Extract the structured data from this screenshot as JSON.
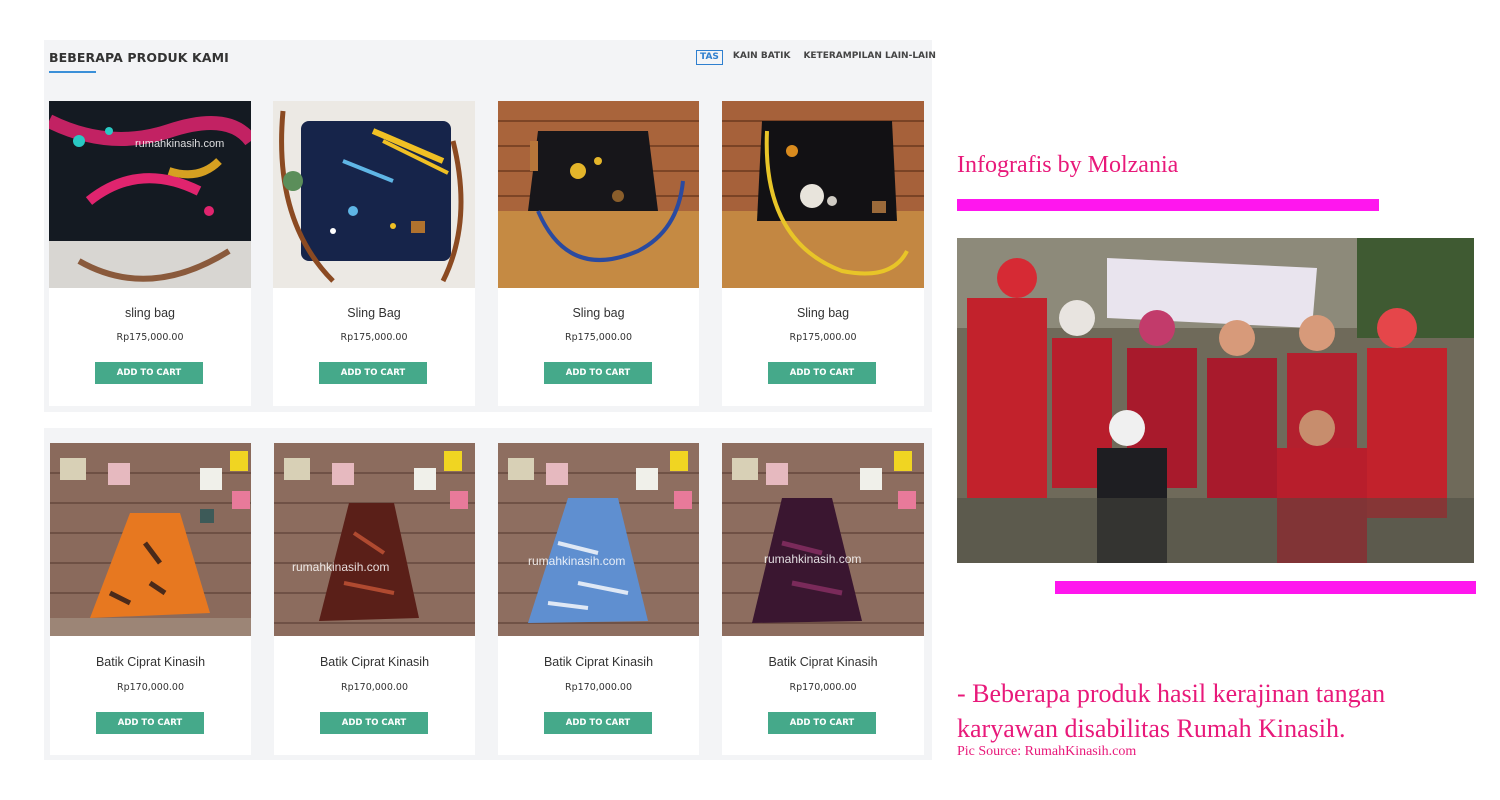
{
  "section": {
    "title": "BEBERAPA PRODUK KAMI",
    "tabs": [
      "TAS",
      "KAIN BATIK",
      "KETERAMPILAN LAIN-LAIN"
    ]
  },
  "products_row1": [
    {
      "name": "sling bag",
      "price": "Rp175,000.00",
      "button": "ADD TO CART",
      "watermark": "rumahkinasih.com"
    },
    {
      "name": "Sling Bag",
      "price": "Rp175,000.00",
      "button": "ADD TO CART"
    },
    {
      "name": "Sling bag",
      "price": "Rp175,000.00",
      "button": "ADD TO CART"
    },
    {
      "name": "Sling bag",
      "price": "Rp175,000.00",
      "button": "ADD TO CART"
    }
  ],
  "products_row2": [
    {
      "name": "Batik Ciprat Kinasih",
      "price": "Rp170,000.00",
      "button": "ADD TO CART"
    },
    {
      "name": "Batik Ciprat Kinasih",
      "price": "Rp170,000.00",
      "button": "ADD TO CART",
      "watermark": "rumahkinasih.com"
    },
    {
      "name": "Batik Ciprat Kinasih",
      "price": "Rp170,000.00",
      "button": "ADD TO CART",
      "watermark": "rumahkinasih.com"
    },
    {
      "name": "Batik Ciprat Kinasih",
      "price": "Rp170,000.00",
      "button": "ADD TO CART",
      "watermark": "rumahkinasih.com"
    }
  ],
  "infografis": {
    "title": "Infografis by Molzania",
    "caption_line1": "- Beberapa produk hasil kerajinan tangan",
    "caption_line2": "karyawan disabilitas Rumah Kinasih.",
    "pic_source": "Pic Source: RumahKinasih.com"
  },
  "colors": {
    "accent_pink": "#e8197a",
    "bar_magenta": "#ff16ee",
    "cart_green": "#45a98a",
    "tab_blue": "#2e7fcf"
  }
}
